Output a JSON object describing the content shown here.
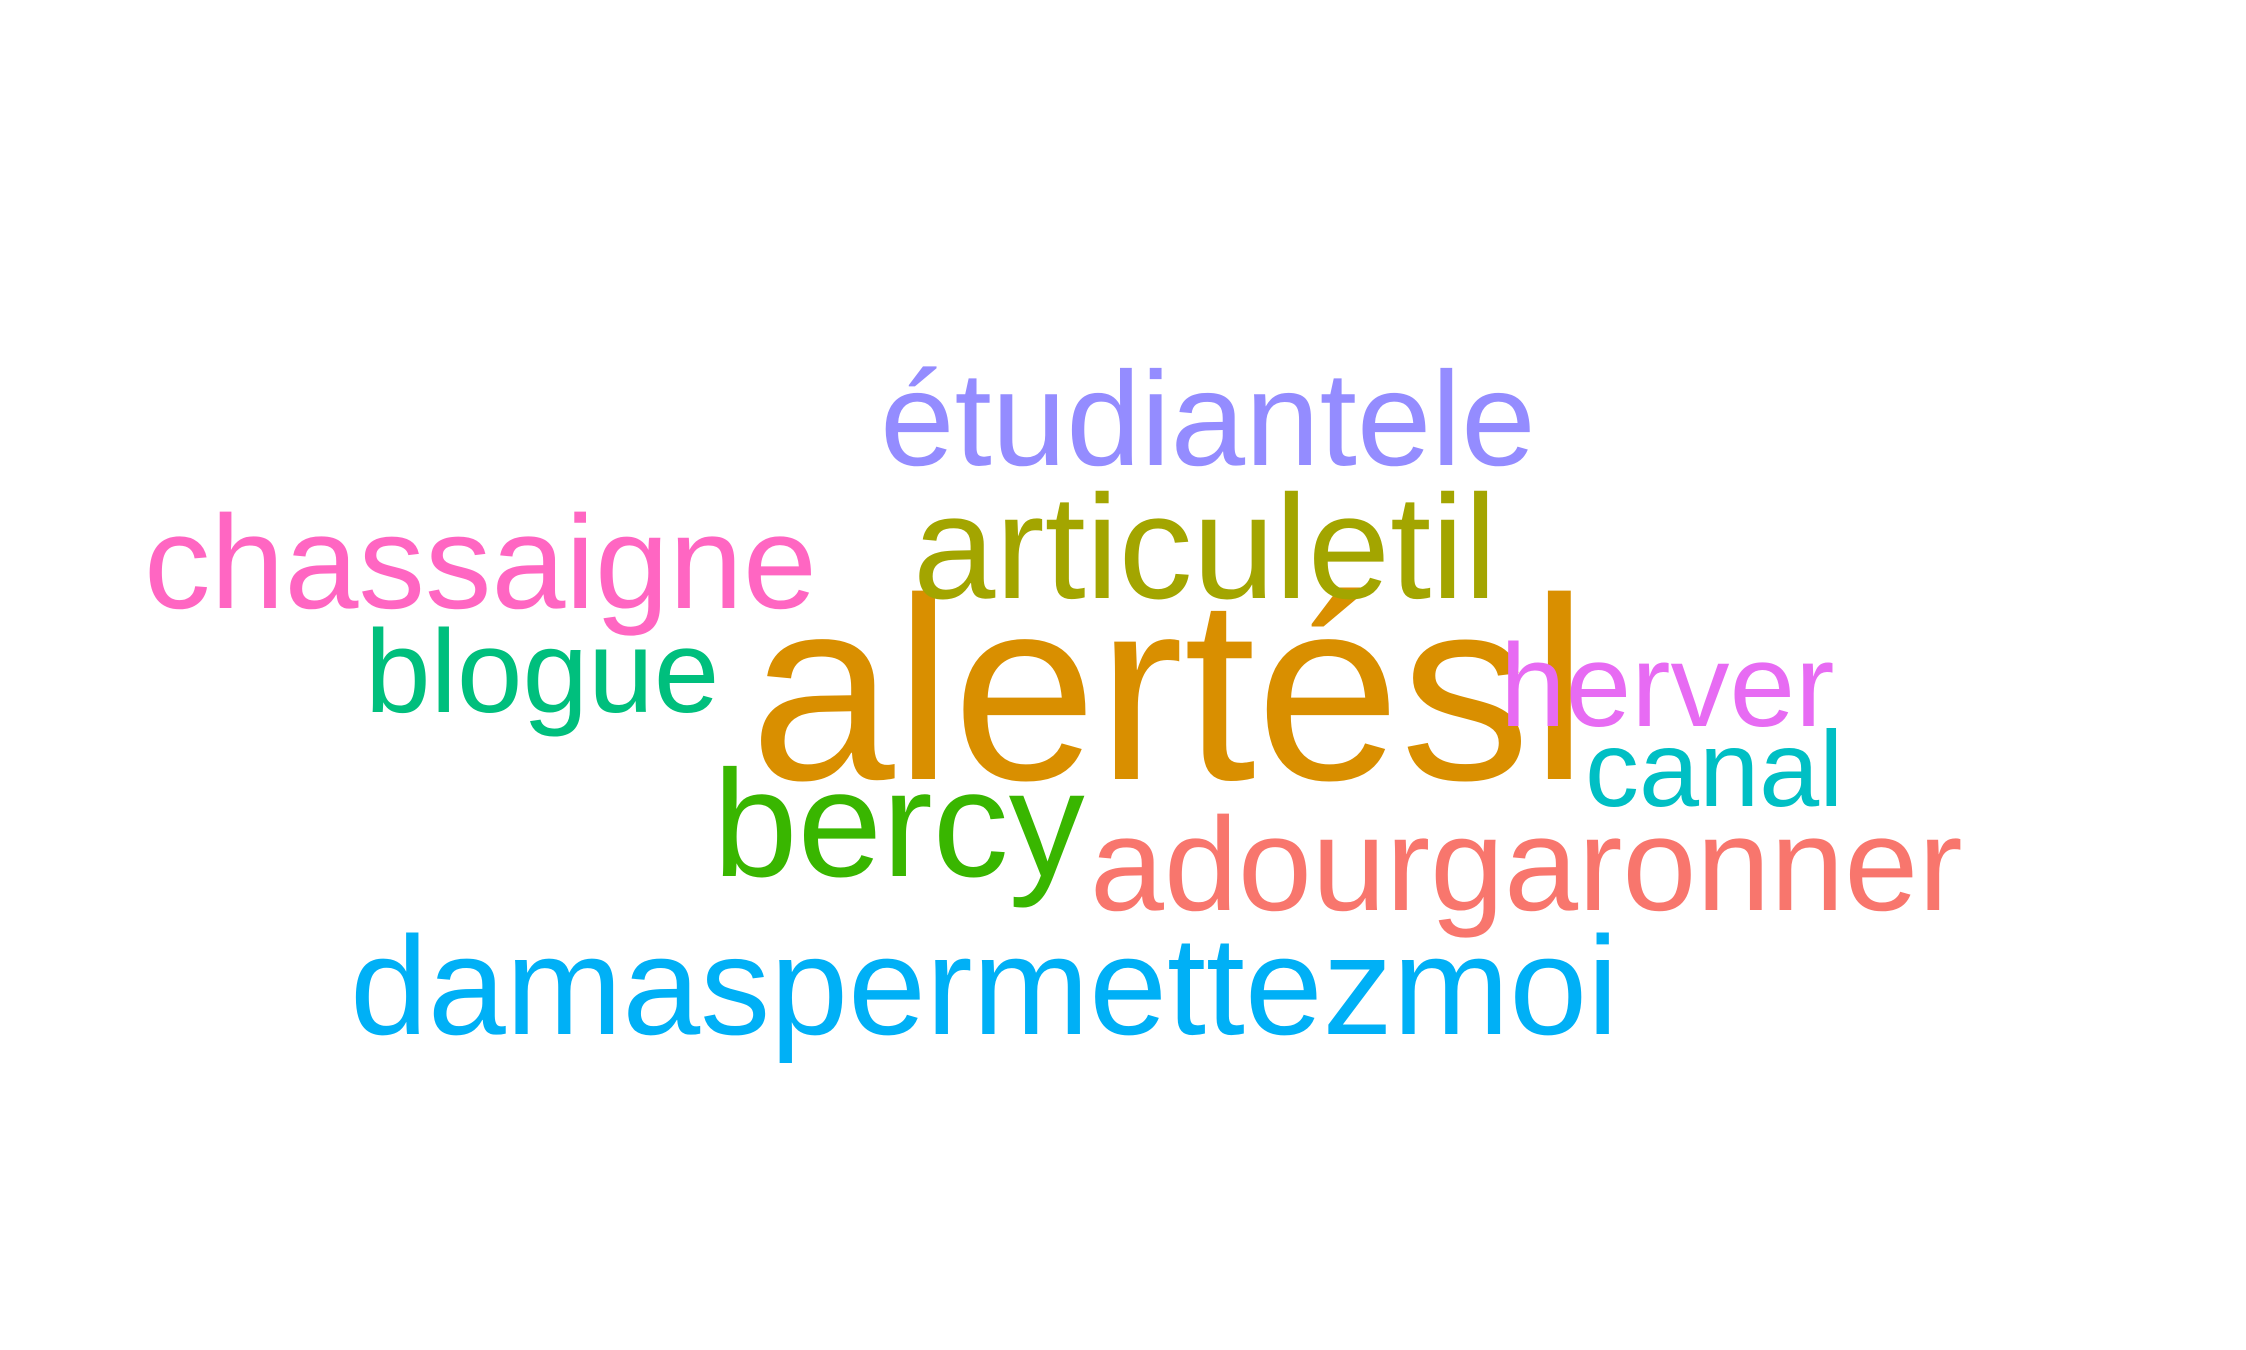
{
  "words": [
    {
      "key": "alertesl",
      "text": "alertésl",
      "color": "#D98F00"
    },
    {
      "key": "etudiantele",
      "text": "étudiantele",
      "color": "#948CFF"
    },
    {
      "key": "chassaigne",
      "text": "chassaigne",
      "color": "#FF66C2"
    },
    {
      "key": "articuletil",
      "text": "articuletil",
      "color": "#A3A500"
    },
    {
      "key": "blogue",
      "text": "blogue",
      "color": "#00BF7D"
    },
    {
      "key": "herver",
      "text": "herver",
      "color": "#E76BF3"
    },
    {
      "key": "canal",
      "text": "canal",
      "color": "#00BFC4"
    },
    {
      "key": "bercy",
      "text": "bercy",
      "color": "#39B600"
    },
    {
      "key": "adourgaronner",
      "text": "adourgaronner",
      "color": "#F8766D"
    },
    {
      "key": "damaspermettezmoi",
      "text": "damaspermettezmoi",
      "color": "#00B0F6"
    }
  ]
}
